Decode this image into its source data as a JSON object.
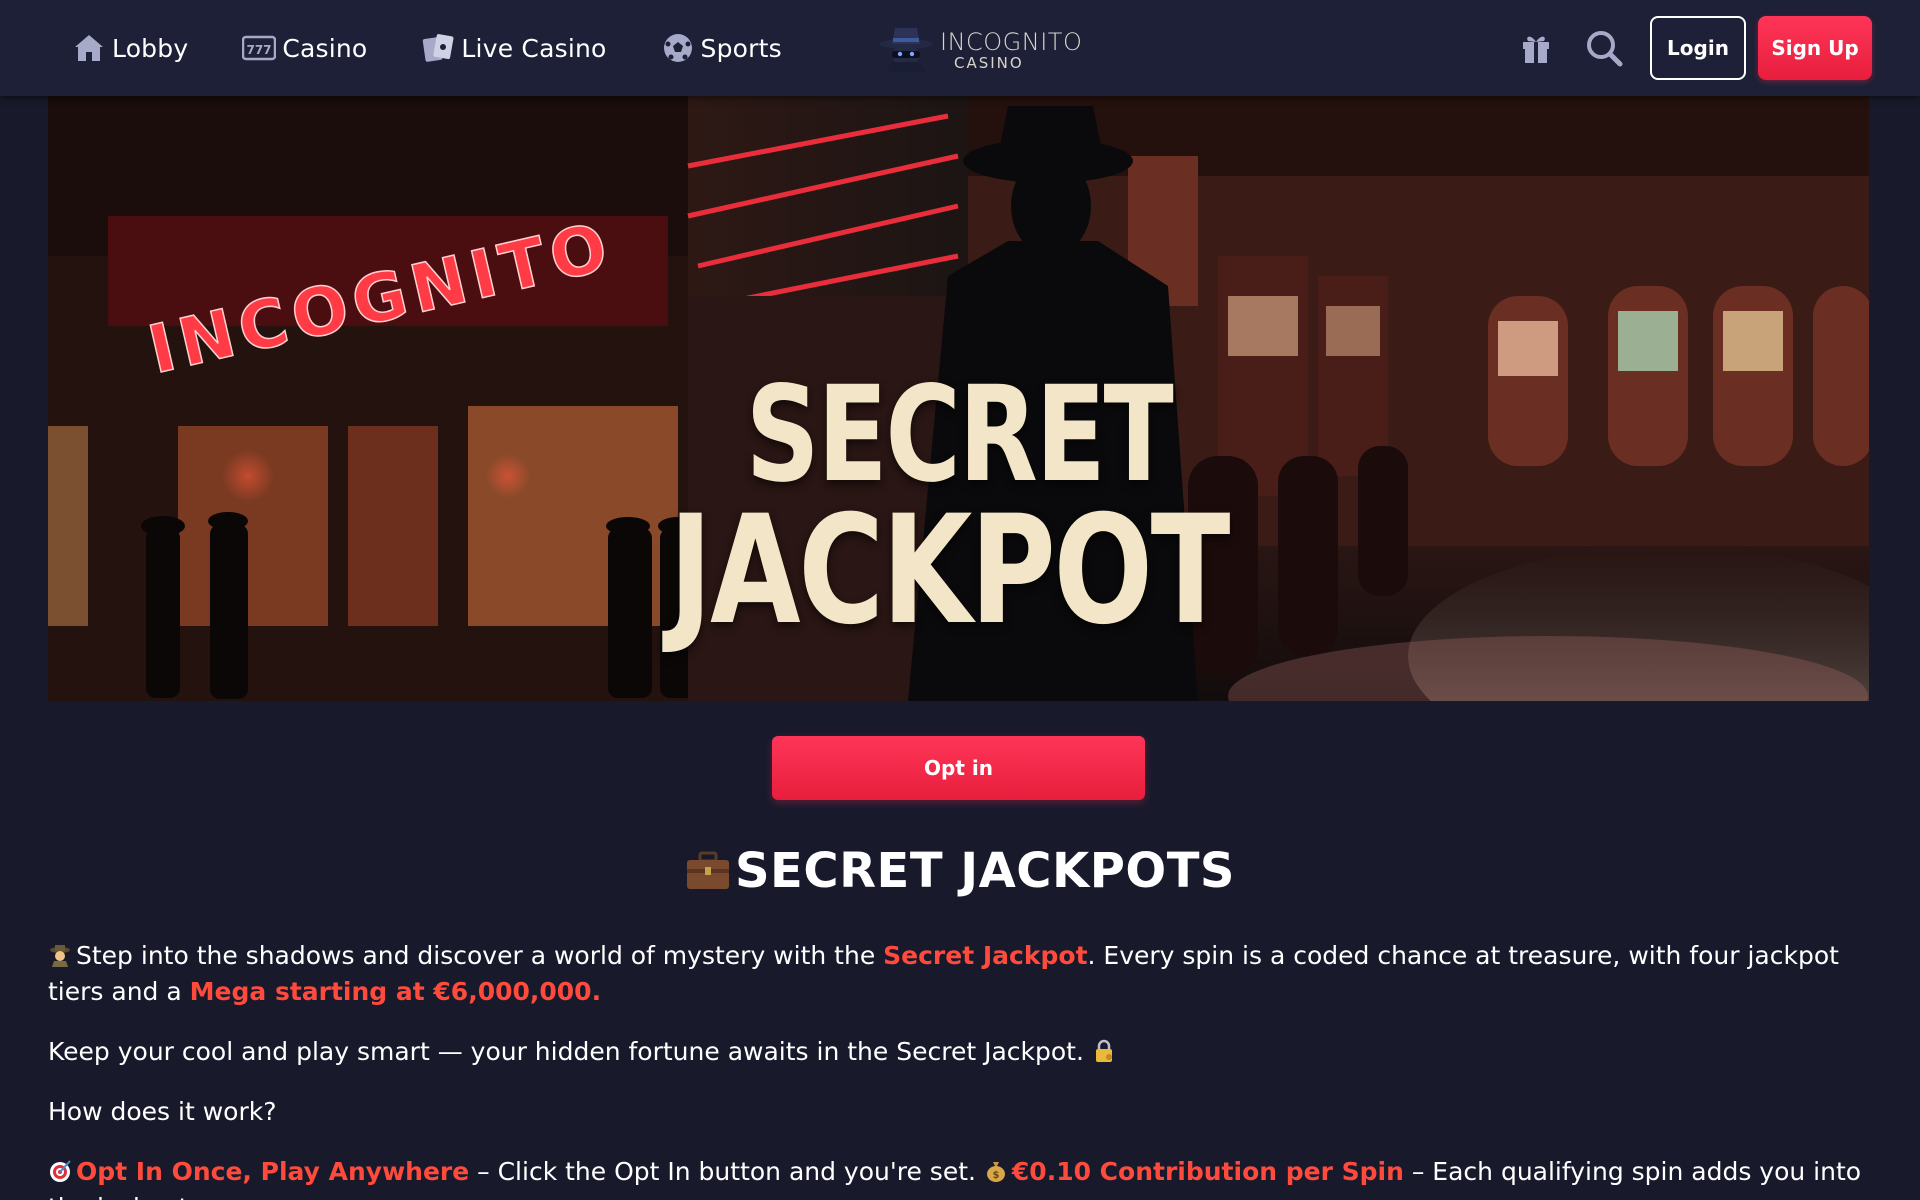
{
  "header": {
    "nav": [
      {
        "label": "Lobby",
        "icon": "home-icon"
      },
      {
        "label": "Casino",
        "icon": "slot-777-icon"
      },
      {
        "label": "Live Casino",
        "icon": "playing-cards-icon"
      },
      {
        "label": "Sports",
        "icon": "soccer-ball-icon"
      }
    ],
    "logo": {
      "name": "INCOGNITO",
      "sub": "CASINO"
    },
    "gift_icon": "gift-icon",
    "search_icon": "search-icon",
    "login_label": "Login",
    "signup_label": "Sign Up"
  },
  "banner": {
    "neon_sign": "INCOGNITO",
    "title_line1": "SECRET",
    "title_line2": "JACKPOT"
  },
  "optin_label": "Opt in",
  "main": {
    "heading": "SECRET JACKPOTS",
    "heading_icon": "briefcase-icon",
    "p1": {
      "icon": "detective-icon",
      "t1": "Step into the shadows and discover a world of mystery with the ",
      "hl1": "Secret Jackpot",
      "t2": ". Every spin is a coded chance at treasure, with four jackpot tiers and a ",
      "hl2": "Mega starting at €6,000,000."
    },
    "p2": {
      "text": "Keep your cool and play smart — your hidden fortune awaits in the Secret Jackpot.",
      "icon": "locked-key-icon"
    },
    "p3": "How does it work?",
    "p4": {
      "icon1": "target-icon",
      "hl1": "Opt In Once, Play Anywhere",
      "t1": " – Click the Opt In button and you're set. ",
      "icon2": "money-bag-icon",
      "hl2": "€0.10 Contribution per Spin",
      "t2": " – Each qualifying spin adds you into the jackpot"
    }
  },
  "colors": {
    "background": "#181a2c",
    "header": "#1d2036",
    "accent": "#ff3558",
    "highlight_text": "#ff4a3c",
    "banner_title": "#f3e6c8"
  }
}
